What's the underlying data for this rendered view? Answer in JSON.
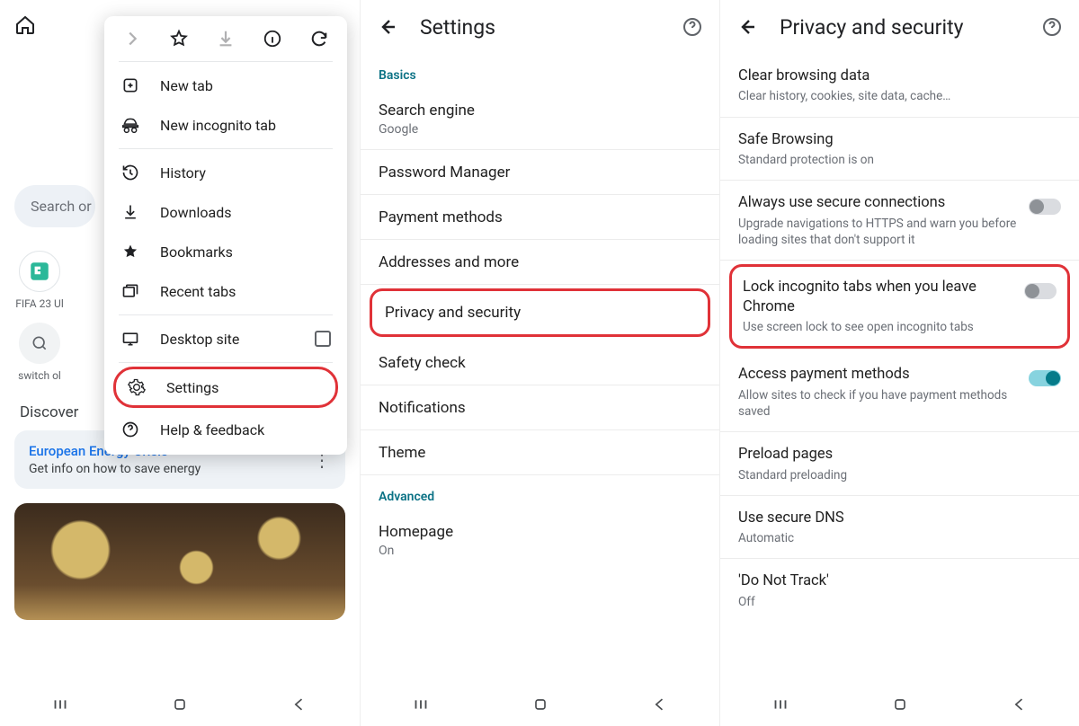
{
  "pane1": {
    "search_placeholder": "Search or",
    "tiles": {
      "fifa": "FIFA 23 Ul",
      "switch": "switch ol"
    },
    "discover": "Discover",
    "card": {
      "title": "European Energy Crisis",
      "sub": "Get info on how to save energy"
    },
    "menu": {
      "new_tab": "New tab",
      "incognito": "New incognito tab",
      "history": "History",
      "downloads": "Downloads",
      "bookmarks": "Bookmarks",
      "recent": "Recent tabs",
      "desktop": "Desktop site",
      "settings": "Settings",
      "help": "Help & feedback"
    }
  },
  "pane2": {
    "title": "Settings",
    "basics": "Basics",
    "advanced": "Advanced",
    "items": {
      "search_engine": "Search engine",
      "search_engine_sub": "Google",
      "password": "Password Manager",
      "payment": "Payment methods",
      "addresses": "Addresses and more",
      "privacy": "Privacy and security",
      "safety": "Safety check",
      "notifications": "Notifications",
      "theme": "Theme",
      "homepage": "Homepage",
      "homepage_sub": "On"
    }
  },
  "pane3": {
    "title": "Privacy and security",
    "items": {
      "clear_t": "Clear browsing data",
      "clear_s": "Clear history, cookies, site data, cache…",
      "safe_t": "Safe Browsing",
      "safe_s": "Standard protection is on",
      "https_t": "Always use secure connections",
      "https_s": "Upgrade navigations to HTTPS and warn you before loading sites that don't support it",
      "lock_t": "Lock incognito tabs when you leave Chrome",
      "lock_s": "Use screen lock to see open incognito tabs",
      "pay_t": "Access payment methods",
      "pay_s": "Allow sites to check if you have payment methods saved",
      "preload_t": "Preload pages",
      "preload_s": "Standard preloading",
      "dns_t": "Use secure DNS",
      "dns_s": "Automatic",
      "dnt_t": "'Do Not Track'",
      "dnt_s": "Off"
    }
  }
}
